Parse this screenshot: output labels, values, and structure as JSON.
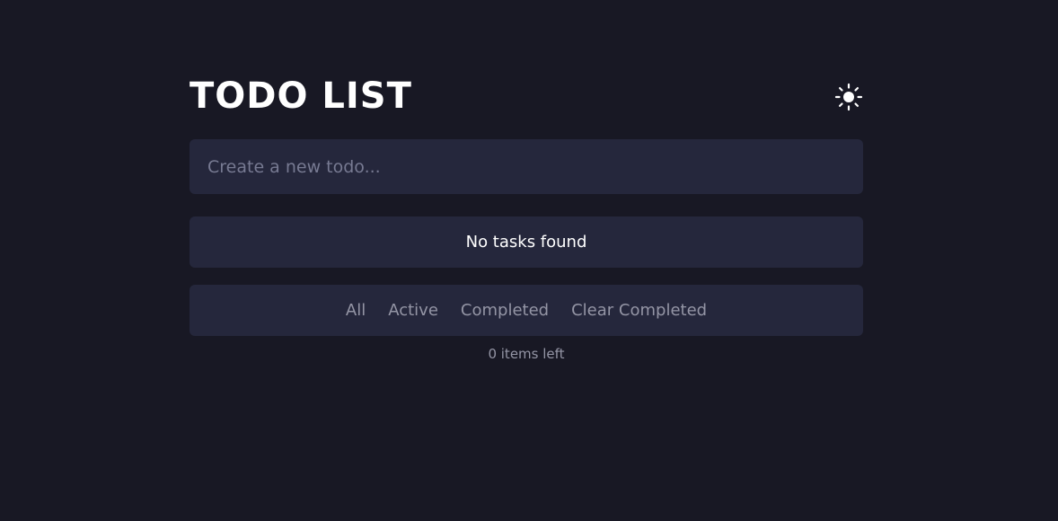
{
  "header": {
    "title": "TODO LIST",
    "theme_icon": "sun-icon"
  },
  "input": {
    "placeholder": "Create a new todo...",
    "value": ""
  },
  "list": {
    "empty_message": "No tasks found"
  },
  "filters": {
    "all": "All",
    "active": "Active",
    "completed": "Completed",
    "clear_completed": "Clear Completed"
  },
  "footer": {
    "items_left": "0 items left"
  },
  "colors": {
    "background": "#181824",
    "panel": "#25273c",
    "text_primary": "#ffffff",
    "text_muted": "#9495a5"
  }
}
